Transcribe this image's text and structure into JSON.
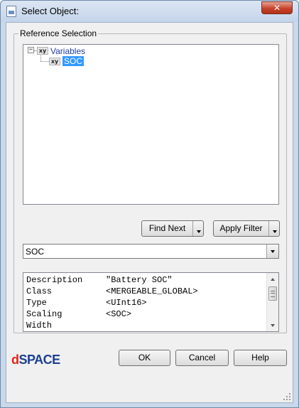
{
  "window": {
    "title": "Select Object:",
    "close_glyph": "✕"
  },
  "reference_selection": {
    "group_label": "Reference Selection",
    "tree": {
      "root": {
        "expander": "−",
        "icon": "xy",
        "label": "Variables"
      },
      "children": [
        {
          "icon": "xy",
          "label": "SOC",
          "selected": true
        }
      ]
    },
    "find_next_label": "Find Next",
    "apply_filter_label": "Apply Filter",
    "selected_value": "SOC",
    "properties": [
      {
        "key": "Description",
        "value": "\"Battery SOC\""
      },
      {
        "key": "Class",
        "value": "<MERGEABLE_GLOBAL>"
      },
      {
        "key": "Type",
        "value": "<UInt16>"
      },
      {
        "key": "Scaling",
        "value": "<SOC>"
      },
      {
        "key": "Width",
        "value": ""
      }
    ]
  },
  "footer": {
    "logo_d": "d",
    "logo_rest": "SPACE",
    "ok_label": "OK",
    "cancel_label": "Cancel",
    "help_label": "Help"
  },
  "colors": {
    "selection": "#3399ff",
    "link_text": "#1f3fa8",
    "logo_red": "#e2231a",
    "logo_blue": "#1d3f8f"
  }
}
